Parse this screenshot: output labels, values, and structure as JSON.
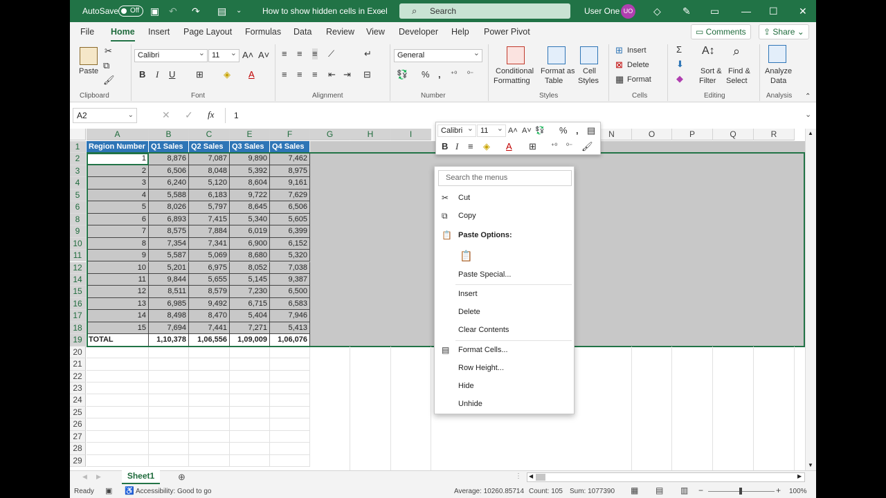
{
  "title_bar": {
    "autosave_label": "AutoSave",
    "autosave_state": "Off",
    "doc_title": "How to show hidden cells in Excel",
    "search_placeholder": "Search",
    "user_name": "User One",
    "user_initials": "UO"
  },
  "menu": {
    "tabs": [
      "File",
      "Home",
      "Insert",
      "Page Layout",
      "Formulas",
      "Data",
      "Review",
      "View",
      "Developer",
      "Help",
      "Power Pivot"
    ],
    "active_tab": "Home",
    "comments_label": "Comments",
    "share_label": "Share"
  },
  "ribbon": {
    "paste_label": "Paste",
    "clipboard_label": "Clipboard",
    "font_name": "Calibri",
    "font_size": "11",
    "font_label": "Font",
    "alignment_label": "Alignment",
    "number_format": "General",
    "number_label": "Number",
    "cond_format_1": "Conditional",
    "cond_format_2": "Formatting",
    "format_table_1": "Format as",
    "format_table_2": "Table",
    "cell_styles_1": "Cell",
    "cell_styles_2": "Styles",
    "styles_label": "Styles",
    "insert_label": "Insert",
    "delete_label": "Delete",
    "format_label": "Format",
    "cells_label": "Cells",
    "sort_1": "Sort &",
    "sort_2": "Filter",
    "find_1": "Find &",
    "find_2": "Select",
    "editing_label": "Editing",
    "analyze_1": "Analyze",
    "analyze_2": "Data",
    "analysis_label": "Analysis"
  },
  "formula_bar": {
    "name_box": "A2",
    "fx": "fx",
    "value": "1"
  },
  "grid": {
    "columns": [
      "A",
      "B",
      "C",
      "E",
      "F",
      "G",
      "H",
      "I",
      "N",
      "O",
      "P",
      "Q",
      "R"
    ],
    "header_row": [
      "Region Number",
      "Q1 Sales",
      "Q2 Sales",
      "Q3 Sales",
      "Q4 Sales"
    ],
    "rows": [
      {
        "row": "2",
        "cells": [
          "1",
          "8,876",
          "7,087",
          "9,890",
          "7,462"
        ]
      },
      {
        "row": "3",
        "cells": [
          "2",
          "6,506",
          "8,048",
          "5,392",
          "8,975"
        ]
      },
      {
        "row": "4",
        "cells": [
          "3",
          "6,240",
          "5,120",
          "8,604",
          "9,161"
        ]
      },
      {
        "row": "5",
        "cells": [
          "4",
          "5,588",
          "6,183",
          "9,722",
          "7,629"
        ]
      },
      {
        "row": "6",
        "cells": [
          "5",
          "8,026",
          "5,797",
          "8,645",
          "6,506"
        ]
      },
      {
        "row": "8",
        "cells": [
          "6",
          "6,893",
          "7,415",
          "5,340",
          "5,605"
        ]
      },
      {
        "row": "9",
        "cells": [
          "7",
          "8,575",
          "7,884",
          "6,019",
          "6,399"
        ]
      },
      {
        "row": "10",
        "cells": [
          "8",
          "7,354",
          "7,341",
          "6,900",
          "6,152"
        ]
      },
      {
        "row": "11",
        "cells": [
          "9",
          "5,587",
          "5,069",
          "8,680",
          "5,320"
        ]
      },
      {
        "row": "12",
        "cells": [
          "10",
          "5,201",
          "6,975",
          "8,052",
          "7,038"
        ]
      },
      {
        "row": "14",
        "cells": [
          "11",
          "9,844",
          "5,655",
          "5,145",
          "9,387"
        ]
      },
      {
        "row": "15",
        "cells": [
          "12",
          "8,511",
          "8,579",
          "7,230",
          "6,500"
        ]
      },
      {
        "row": "16",
        "cells": [
          "13",
          "6,985",
          "9,492",
          "6,715",
          "6,583"
        ]
      },
      {
        "row": "17",
        "cells": [
          "14",
          "8,498",
          "8,470",
          "5,404",
          "7,946"
        ]
      },
      {
        "row": "18",
        "cells": [
          "15",
          "7,694",
          "7,441",
          "7,271",
          "5,413"
        ]
      }
    ],
    "total_row": {
      "row": "19",
      "cells": [
        "TOTAL",
        "1,10,378",
        "1,06,556",
        "1,09,009",
        "1,06,076"
      ]
    },
    "empty_rows": [
      "20",
      "21",
      "22",
      "23",
      "24",
      "25",
      "26",
      "27",
      "28",
      "29"
    ]
  },
  "mini_toolbar": {
    "font_name": "Calibri",
    "font_size": "11"
  },
  "context_menu": {
    "search_placeholder": "Search the menus",
    "cut": "Cut",
    "copy": "Copy",
    "paste_options": "Paste Options:",
    "paste_special": "Paste Special...",
    "insert": "Insert",
    "delete": "Delete",
    "clear_contents": "Clear Contents",
    "format_cells": "Format Cells...",
    "row_height": "Row Height...",
    "hide": "Hide",
    "unhide": "Unhide"
  },
  "sheet_tabs": {
    "active": "Sheet1"
  },
  "status_bar": {
    "ready": "Ready",
    "accessibility": "Accessibility: Good to go",
    "average": "Average: 10260.85714",
    "count": "Count: 105",
    "sum": "Sum: 1077390",
    "zoom": "100%"
  },
  "colors": {
    "excel_green": "#217346",
    "header_blue": "#2e75b6",
    "selection_gray": "#c8c8c8"
  }
}
